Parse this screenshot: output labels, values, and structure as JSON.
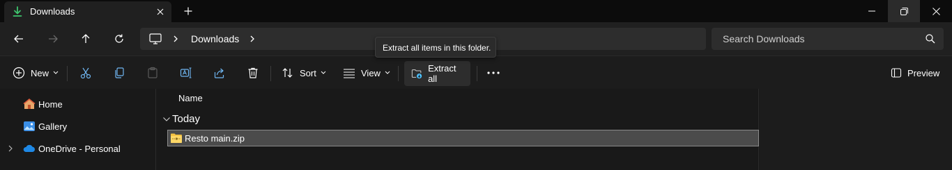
{
  "tab": {
    "title": "Downloads",
    "icon": "download-arrow-icon"
  },
  "window_controls": [
    "minimize-icon",
    "restore-icon",
    "close-icon"
  ],
  "address": {
    "location_icon": "this-pc-icon",
    "path": "Downloads"
  },
  "search": {
    "placeholder": "Search Downloads"
  },
  "commands": {
    "new_label": "New",
    "sort_label": "Sort",
    "view_label": "View",
    "extract_label": "Extract all",
    "preview_label": "Preview"
  },
  "tooltip": {
    "text": "Extract all items in this folder."
  },
  "navigation": {
    "items": [
      {
        "label": "Home",
        "icon": "home-icon",
        "expandable": false
      },
      {
        "label": "Gallery",
        "icon": "gallery-icon",
        "expandable": false
      },
      {
        "label": "OneDrive - Personal",
        "icon": "onedrive-cloud-icon",
        "expandable": true
      }
    ]
  },
  "files": {
    "column_name": "Name",
    "group_label": "Today",
    "items": [
      {
        "name": "Resto main.zip",
        "icon": "zip-folder-icon",
        "selected": true
      }
    ]
  },
  "colors": {
    "titlebar_bg": "#0c0c0c",
    "toolbar_bg": "#202020",
    "content_bg": "#191919",
    "selection_bg": "#4b4b4b",
    "accent_blue": "#4cc2ff",
    "folder_yellow": "#f5c242"
  }
}
